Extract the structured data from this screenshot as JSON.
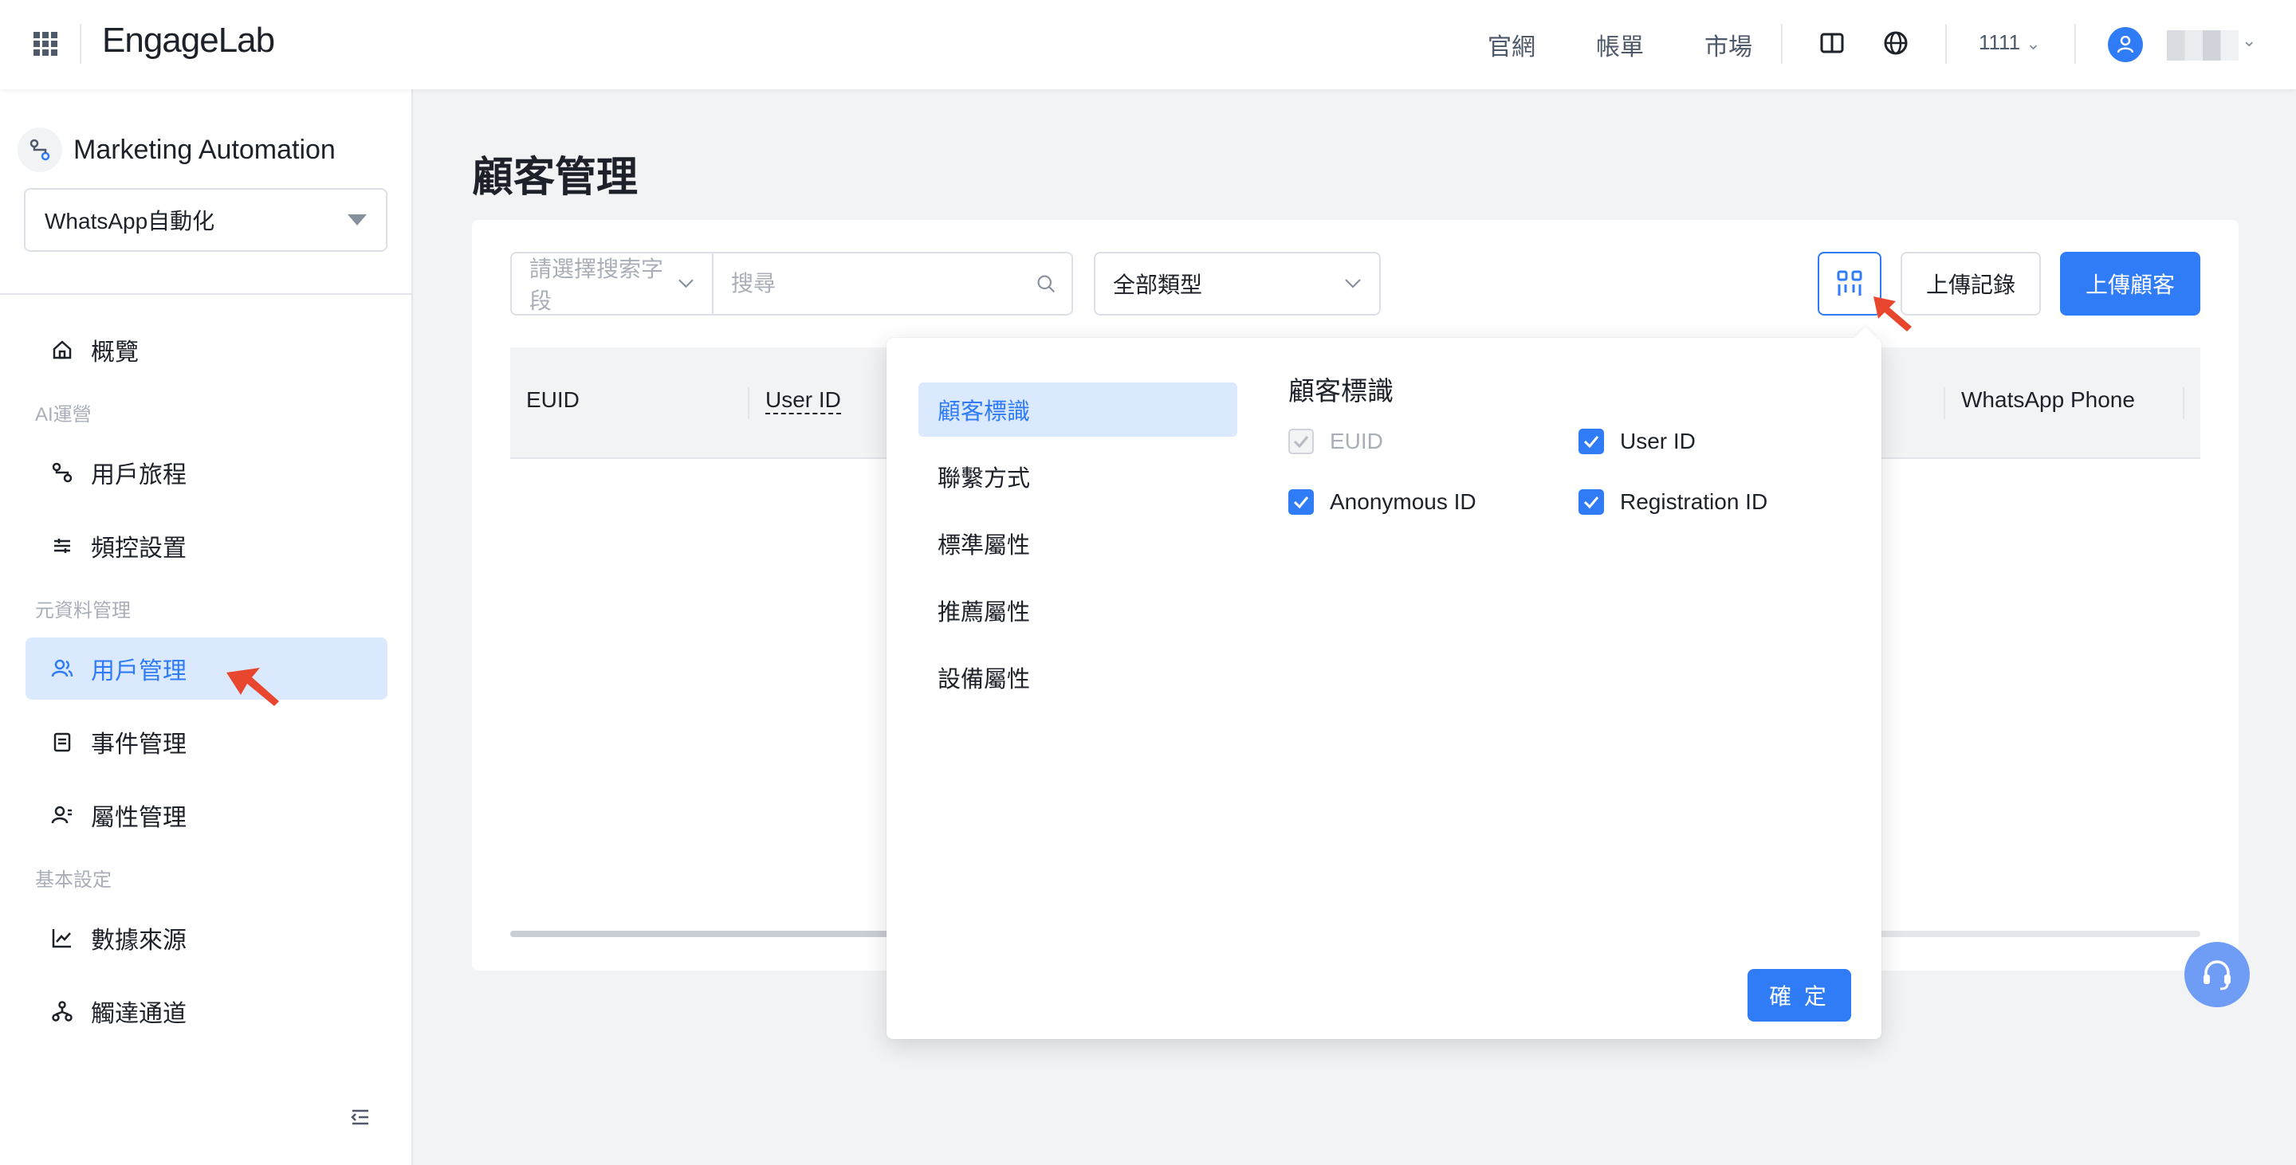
{
  "header": {
    "logo": "EngageLab",
    "links": [
      "官網",
      "帳單",
      "市場"
    ],
    "account": "1111",
    "icons": [
      "apps-grid-icon",
      "book-icon",
      "globe-icon",
      "user-icon"
    ]
  },
  "sidebar": {
    "product": "Marketing Automation",
    "project": "WhatsApp自動化",
    "items": {
      "overview": "概覽",
      "group_ai": "AI運營",
      "journey": "用戶旅程",
      "frequency": "頻控設置",
      "group_meta": "元資料管理",
      "users": "用戶管理",
      "events": "事件管理",
      "attributes": "屬性管理",
      "group_basic": "基本設定",
      "datasource": "數據來源",
      "channels": "觸達通道"
    }
  },
  "main": {
    "title": "顧客管理",
    "filters": {
      "field_placeholder": "請選擇搜索字段",
      "search_placeholder": "搜尋",
      "type_value": "全部類型"
    },
    "buttons": {
      "upload_history": "上傳記錄",
      "upload_customers": "上傳顧客"
    },
    "table": {
      "columns": [
        "EUID",
        "User ID",
        "WhatsApp Phone"
      ]
    }
  },
  "popover": {
    "categories": [
      "顧客標識",
      "聯繫方式",
      "標準屬性",
      "推薦屬性",
      "設備屬性"
    ],
    "active_category": "顧客標識",
    "group_title": "顧客標識",
    "options": [
      {
        "label": "EUID",
        "checked": true,
        "disabled": true
      },
      {
        "label": "User ID",
        "checked": true,
        "disabled": false
      },
      {
        "label": "Anonymous ID",
        "checked": true,
        "disabled": false
      },
      {
        "label": "Registration ID",
        "checked": true,
        "disabled": false
      }
    ],
    "confirm": "確 定"
  },
  "colors": {
    "primary": "#2f7cf6",
    "active_bg": "#dbe9ff",
    "annotation_arrow": "#e8462f"
  }
}
